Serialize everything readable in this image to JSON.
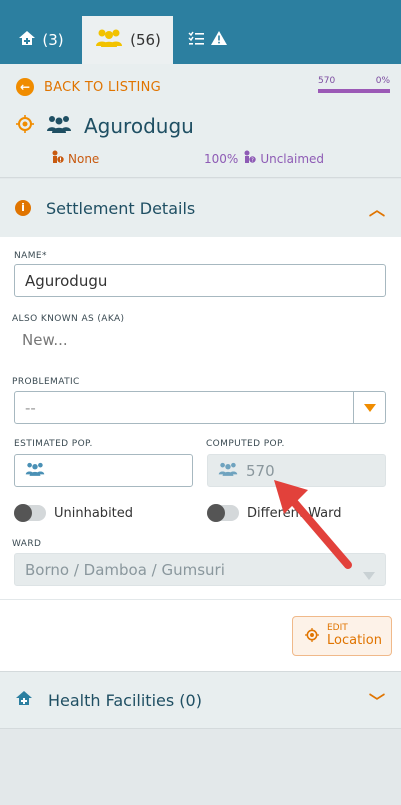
{
  "tabs": [
    {
      "count": "(3)",
      "icon": "home-plus-icon"
    },
    {
      "count": "(56)",
      "icon": "people-icon"
    },
    {
      "count": "",
      "icon": "checklist-warning-icon"
    }
  ],
  "header": {
    "back_label": "BACK TO LISTING",
    "progress_left": "570",
    "progress_right": "0%",
    "progress_fraction": 1.0,
    "settlement_name": "Agurodugu",
    "problem_status": "None",
    "claimed_status": "100%",
    "claimed_label": "Unclaimed"
  },
  "settlement_section": {
    "title": "Settlement Details"
  },
  "form": {
    "name_label": "NAME*",
    "name_value": "Agurodugu",
    "aka_label": "ALSO KNOWN AS (AKA)",
    "aka_placeholder": "New...",
    "problematic_label": "PROBLEMATIC",
    "problematic_value": "--",
    "estimated_pop_label": "ESTIMATED POP.",
    "estimated_pop_value": "",
    "computed_pop_label": "COMPUTED POP.",
    "computed_pop_value": "570",
    "uninhabited_label": "Uninhabited",
    "different_ward_label": "Different Ward",
    "ward_label": "WARD",
    "ward_value": "Borno / Damboa / Gumsuri",
    "edit_small": "EDIT",
    "edit_big": "Location"
  },
  "health_section": {
    "title": "Health Facilities (0)"
  },
  "colors": {
    "tab_blue": "#2c7fa0",
    "accent_orange": "#e07400",
    "purple": "#9b59b6",
    "arrow_red": "#e2413b"
  }
}
